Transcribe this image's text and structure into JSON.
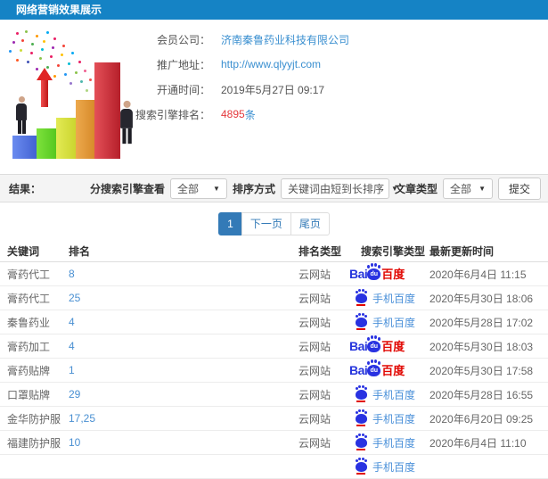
{
  "header": {
    "title": "网络营销效果展示"
  },
  "info": {
    "fields": [
      {
        "label": "会员公司：",
        "value": "济南秦鲁药业科技有限公司",
        "style": "link"
      },
      {
        "label": "推广地址：",
        "value": "http://www.qlyyjt.com",
        "style": "link"
      },
      {
        "label": "开通时间：",
        "value": "2019年5月27日 09:17",
        "style": "plain"
      },
      {
        "label": "搜索引擎排名：",
        "value": "4895",
        "suffix": "条",
        "style": "count"
      }
    ]
  },
  "filters": {
    "result_label": "结果：",
    "engine_label": "分搜索引擎查看",
    "engine_value": "全部",
    "sort_label": "排序方式",
    "sort_value": "关键词由短到长排序",
    "type_label": "文章类型",
    "type_value": "全部",
    "submit_label": "提交",
    "caret": "▼"
  },
  "pagination": {
    "current": "1",
    "next": "下一页",
    "last": "尾页"
  },
  "table": {
    "headers": [
      "关键词",
      "排名",
      "排名类型",
      "搜索引擎类型",
      "最新更新时间"
    ],
    "rows": [
      {
        "keyword": "膏药代工",
        "rank": "8",
        "rank_type": "云网站",
        "engine": "baidu-pc",
        "updated": "2020年6月4日 11:15"
      },
      {
        "keyword": "膏药代工",
        "rank": "25",
        "rank_type": "云网站",
        "engine": "baidu-mobile",
        "updated": "2020年5月30日 18:06"
      },
      {
        "keyword": "秦鲁药业",
        "rank": "4",
        "rank_type": "云网站",
        "engine": "baidu-mobile",
        "updated": "2020年5月28日 17:02"
      },
      {
        "keyword": "膏药加工",
        "rank": "4",
        "rank_type": "云网站",
        "engine": "baidu-pc",
        "updated": "2020年5月30日 18:03"
      },
      {
        "keyword": "膏药贴牌",
        "rank": "1",
        "rank_type": "云网站",
        "engine": "baidu-pc",
        "updated": "2020年5月30日 17:58"
      },
      {
        "keyword": "口罩贴牌",
        "rank": "29",
        "rank_type": "云网站",
        "engine": "baidu-mobile",
        "updated": "2020年5月28日 16:55"
      },
      {
        "keyword": "金华防护服",
        "rank": "17,25",
        "rank_type": "云网站",
        "engine": "baidu-mobile",
        "updated": "2020年6月20日 09:25"
      },
      {
        "keyword": "福建防护服",
        "rank": "10",
        "rank_type": "云网站",
        "engine": "baidu-mobile",
        "updated": "2020年6月4日 11:10"
      }
    ],
    "partial_row": {
      "engine": "baidu-mobile"
    }
  },
  "logos": {
    "baidu_pc": {
      "bai": "Bai",
      "du": "du",
      "cn": "百度"
    },
    "baidu_mobile": {
      "label": "手机百度"
    }
  },
  "colors": {
    "header_blue": "#1583c5",
    "link_blue": "#3a8fd0",
    "count_red": "#e4393c",
    "pagination_blue": "#337ab7",
    "baidu_blue": "#2932e1",
    "baidu_red": "#e10601"
  }
}
